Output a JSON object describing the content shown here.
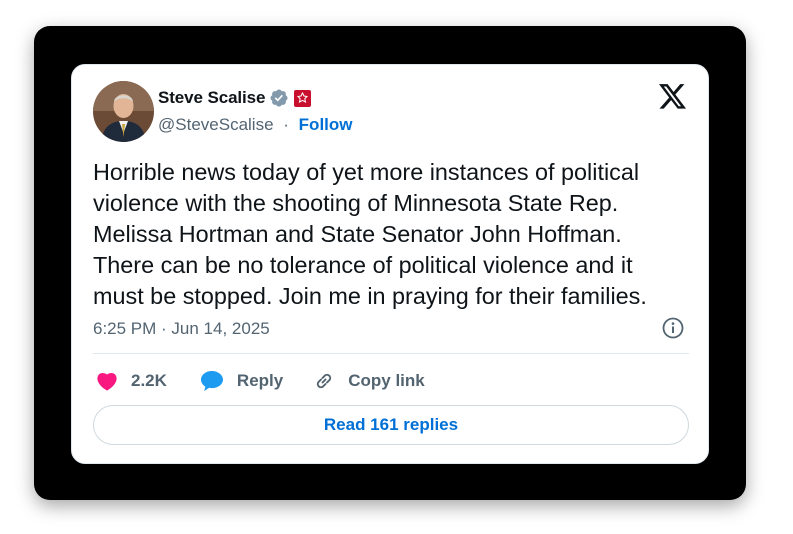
{
  "author": {
    "name": "Steve Scalise",
    "handle": "@SteveScalise",
    "separator": "·",
    "follow_label": "Follow",
    "avatar_icon": "user-avatar",
    "verified_icon": "verified-badge-icon",
    "affiliation_icon": "affiliation-badge-icon"
  },
  "brand_icon": "x-logo-icon",
  "post": {
    "text": "Horrible news today of yet more instances of political\nviolence with the shooting of Minnesota State Rep.\nMelissa Hortman and State Senator John Hoffman.\nThere can be no tolerance of political violence and it\nmust be stopped. Join me in praying for their families.",
    "timestamp": "6:25 PM · Jun 14, 2025"
  },
  "actions": {
    "like_count": "2.2K",
    "reply_label": "Reply",
    "copy_link_label": "Copy link"
  },
  "read_replies_label": "Read 161 replies",
  "colors": {
    "frame": "#000000",
    "text": "#0f1419",
    "secondary": "#536471",
    "link": "#006fd6",
    "like": "#f91880",
    "reply": "#1d9bf0",
    "affiliation": "#c8102e"
  }
}
